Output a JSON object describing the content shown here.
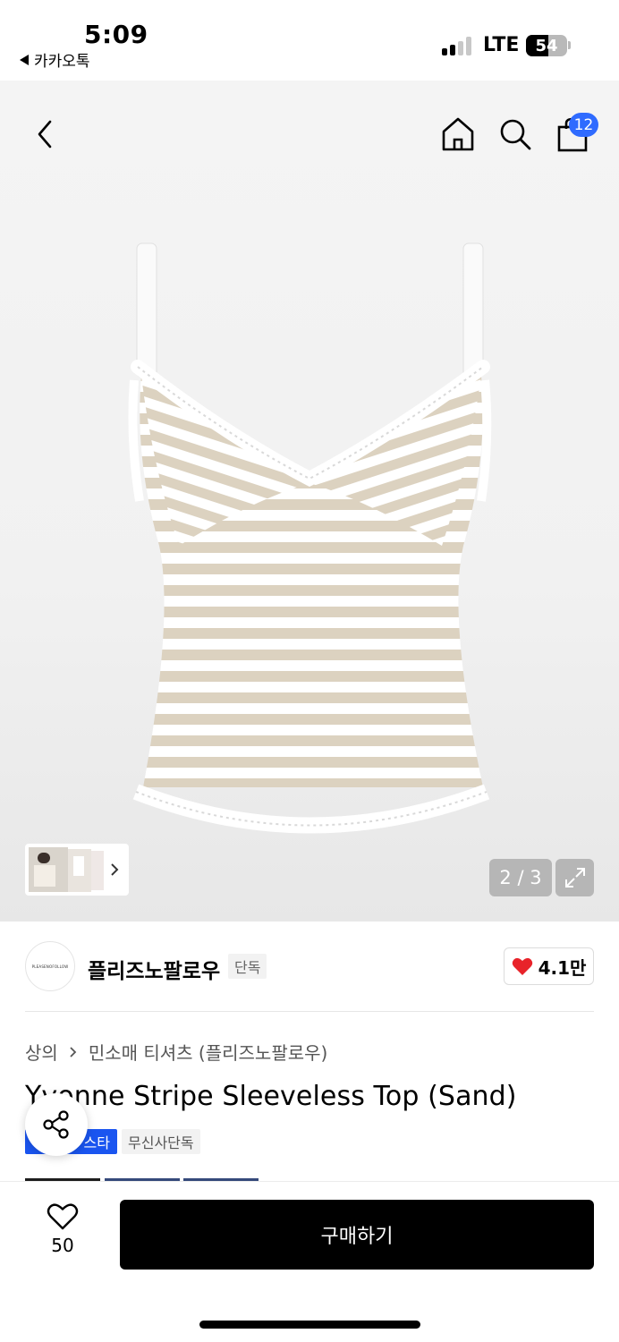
{
  "status_bar": {
    "time": "5:09",
    "back_app": "카카오톡",
    "network": "LTE",
    "battery": "54",
    "battery_fraction": 0.54,
    "signal_bars": 2
  },
  "header": {
    "back_icon": "chevron-left-icon",
    "home_icon": "home-icon",
    "search_icon": "search-icon",
    "cart_icon": "shopping-bag-icon",
    "cart_count": "12"
  },
  "gallery": {
    "page_counter": "2 / 3",
    "expand_icon": "expand-icon",
    "thumb_icon": "chevron-right-icon"
  },
  "brand": {
    "logo_text": "PLEASENOFOLLOW",
    "name": "플리즈노팔로우",
    "tag": "단독",
    "likes": "4.1만"
  },
  "product": {
    "breadcrumb": [
      "상의",
      "민소매 티셔츠 (플리즈노팔로우)"
    ],
    "title": "Yvonne Stripe Sleeveless Top (Sand)",
    "badges": [
      "스타",
      "무신사단독"
    ]
  },
  "bottom_bar": {
    "wish_count": "50",
    "buy_label": "구매하기"
  },
  "colors": {
    "accent_blue": "#2f6bff",
    "badge_blue": "#1a55f0",
    "heart_red": "#e8232a",
    "stripe_sand": "#dcd2c0"
  }
}
